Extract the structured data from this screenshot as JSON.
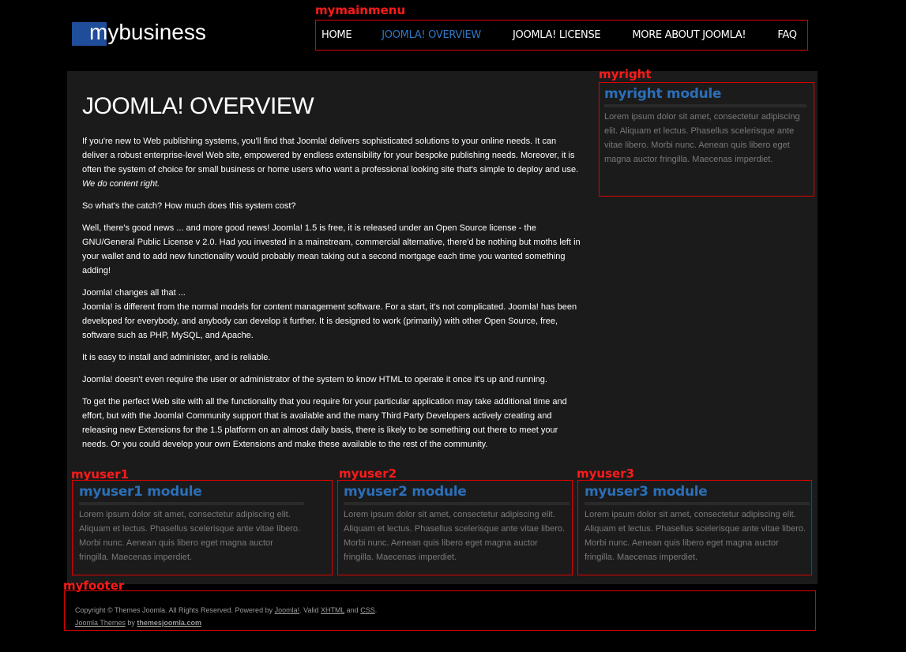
{
  "logo": {
    "text": "mybusiness"
  },
  "positions": {
    "mainmenu": "mymainmenu",
    "right": "myright",
    "user1": "myuser1",
    "user2": "myuser2",
    "user3": "myuser3",
    "footer": "myfooter"
  },
  "menu": {
    "items": [
      {
        "label": "HOME"
      },
      {
        "label": "JOOMLA! OVERVIEW",
        "active": true
      },
      {
        "label": "JOOMLA! LICENSE"
      },
      {
        "label": "MORE ABOUT JOOMLA!"
      },
      {
        "label": "FAQ"
      }
    ]
  },
  "article": {
    "title": "JOOMLA! OVERVIEW",
    "p1": "If you're new to Web publishing systems, you'll find that Joomla! delivers sophisticated solutions to your online needs. It can deliver a robust enterprise-level Web site, empowered by endless extensibility for your bespoke publishing needs. Moreover, it is often the system of choice for small business or home users who want a professional looking site that's simple to deploy and use.",
    "p1_em": "We do content right.",
    "p2": "So what's the catch? How much does this system cost?",
    "p3": "Well, there's good news ... and more good news! Joomla! 1.5 is free, it is released under an Open Source license - the GNU/General Public License v 2.0. Had you invested in a mainstream, commercial alternative, there'd be nothing but moths left in your wallet and to add new functionality would probably mean taking out a second mortgage each time you wanted something adding!",
    "p4a": "Joomla! changes all that ...",
    "p4b": "Joomla! is different from the normal models for content management software. For a start, it's not complicated. Joomla! has been developed for everybody, and anybody can develop it further. It is designed to work (primarily) with other Open Source, free, software such as PHP, MySQL, and Apache.",
    "p5": "It is easy to install and administer, and is reliable.",
    "p6": "Joomla! doesn't even require the user or administrator of the system to know HTML to operate it once it's up and running.",
    "p7": "To get the perfect Web site with all the functionality that you require for your particular application may take additional time and effort, but with the Joomla! Community support that is available and the many Third Party Developers actively creating and releasing new Extensions for the 1.5 platform on an almost daily basis, there is likely to be something out there to meet your needs. Or you could develop your own Extensions and make these available to the rest of the community."
  },
  "modules": {
    "right": {
      "title": "myright module",
      "text": "Lorem ipsum dolor sit amet, consectetur adipiscing elit. Aliquam et lectus. Phasellus scelerisque ante vitae libero. Morbi nunc. Aenean quis libero eget magna auctor fringilla. Maecenas imperdiet."
    },
    "user1": {
      "title": "myuser1 module",
      "text": "Lorem ipsum dolor sit amet, consectetur adipiscing elit. Aliquam et lectus. Phasellus scelerisque ante vitae libero. Morbi nunc. Aenean quis libero eget magna auctor fringilla. Maecenas imperdiet."
    },
    "user2": {
      "title": "myuser2 module",
      "text": "Lorem ipsum dolor sit amet, consectetur adipiscing elit. Aliquam et lectus. Phasellus scelerisque ante vitae libero. Morbi nunc. Aenean quis libero eget magna auctor fringilla. Maecenas imperdiet."
    },
    "user3": {
      "title": "myuser3 module",
      "text": "Lorem ipsum dolor sit amet, consectetur adipiscing elit. Aliquam et lectus. Phasellus scelerisque ante vitae libero. Morbi nunc. Aenean quis libero eget magna auctor fringilla. Maecenas imperdiet."
    }
  },
  "footer": {
    "copyright": "Copyright © Themes Joomla. All Rights Reserved. Powered by",
    "joomla_link": "Joomla!",
    "valid": ". Valid",
    "xhtml": "XHTML",
    "and": "and",
    "css": "CSS",
    "period": ".",
    "themes_link": "Joomla Themes",
    "by": "by",
    "site_link": "themesjoomla.com"
  },
  "colors": {
    "accent": "#2b6fb8",
    "position_label": "#ff1a1a",
    "panel": "#1b1b1b"
  }
}
